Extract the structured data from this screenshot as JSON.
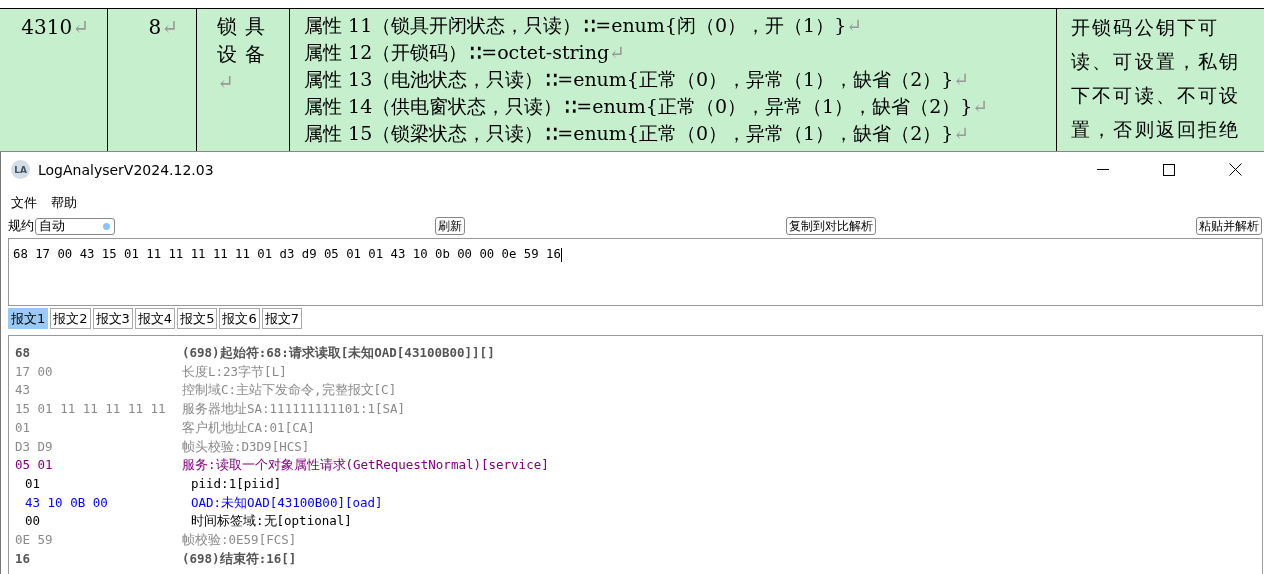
{
  "document_table": {
    "code": {
      "text": "4310",
      "mark": "↵"
    },
    "index": {
      "text": "8",
      "mark": "↵"
    },
    "name": {
      "text": "锁具设备",
      "mark": "↵"
    },
    "attributes": [
      {
        "text": "属性 11（锁具开闭状态，只读）∶∶=enum{闭（0），开（1）}",
        "mark": "↵"
      },
      {
        "text": "属性 12（开锁码）∶∶=octet-string",
        "mark": "↵"
      },
      {
        "text": "属性 13（电池状态，只读）∶∶=enum{正常（0），异常（1），缺省（2）}",
        "mark": "↵"
      },
      {
        "text": "属性 14（供电窗状态，只读）∶∶=enum{正常（0），异常（1），缺省（2）}",
        "mark": "↵"
      },
      {
        "text": "属性 15（锁梁状态，只读）∶∶=enum{正常（0），异常（1），缺省（2）}",
        "mark": "↵"
      }
    ],
    "note_lines": [
      "开锁码公钥下可",
      "读、可设置，私钥",
      "下不可读、不可设",
      "置，否则返回拒绝"
    ]
  },
  "window": {
    "icon_text": "LA",
    "title": "LogAnalyserV2024.12.03",
    "menu": [
      "文件",
      "帮助"
    ],
    "toolbar": {
      "protocol_label": "规约",
      "protocol_value": "自动",
      "buttons": [
        "刷新",
        "复制到对比解析",
        "粘贴并解析"
      ]
    },
    "input": {
      "value": "68 17 00 43 15 01 11 11 11 11 11 01 d3 d9 05 01 01 43 10 0b 00 00 0e 59 16"
    },
    "tabs": [
      {
        "label": "报文1",
        "selected": true
      },
      {
        "label": "报文2",
        "selected": false
      },
      {
        "label": "报文3",
        "selected": false
      },
      {
        "label": "报文4",
        "selected": false
      },
      {
        "label": "报文5",
        "selected": false
      },
      {
        "label": "报文6",
        "selected": false
      },
      {
        "label": "报文7",
        "selected": false
      }
    ],
    "decode_rows": [
      {
        "kind": "frame",
        "hex": "68",
        "desc": "(698)起始符:68:请求读取[未知OAD[43100B00]][]"
      },
      {
        "kind": "field",
        "hex": "17 00",
        "desc": "长度L:23字节[L]"
      },
      {
        "kind": "field",
        "hex": "43",
        "desc": "控制域C:主站下发命令,完整报文[C]"
      },
      {
        "kind": "field",
        "hex": "15 01 11 11 11 11 11",
        "desc": "服务器地址SA:111111111101:1[SA]"
      },
      {
        "kind": "field",
        "hex": "01",
        "desc": "客户机地址CA:01[CA]"
      },
      {
        "kind": "field",
        "hex": "D3 D9",
        "desc": "帧头校验:D3D9[HCS]"
      },
      {
        "kind": "service",
        "hex": "05 01",
        "desc": "服务:读取一个对象属性请求(GetRequestNormal)[service]",
        "children": [
          {
            "kind": "plain",
            "hex": "01",
            "desc": "piid:1[piid]"
          },
          {
            "kind": "oad",
            "hex": "43 10 0B 00",
            "desc": "OAD:未知OAD[43100B00][oad]"
          },
          {
            "kind": "plain",
            "hex": "00",
            "desc": "时间标签域:无[optional]"
          }
        ]
      },
      {
        "kind": "field",
        "hex": "0E 59",
        "desc": "帧校验:0E59[FCS]"
      },
      {
        "kind": "frame",
        "hex": "16",
        "desc": "(698)结束符:16[]"
      }
    ]
  }
}
